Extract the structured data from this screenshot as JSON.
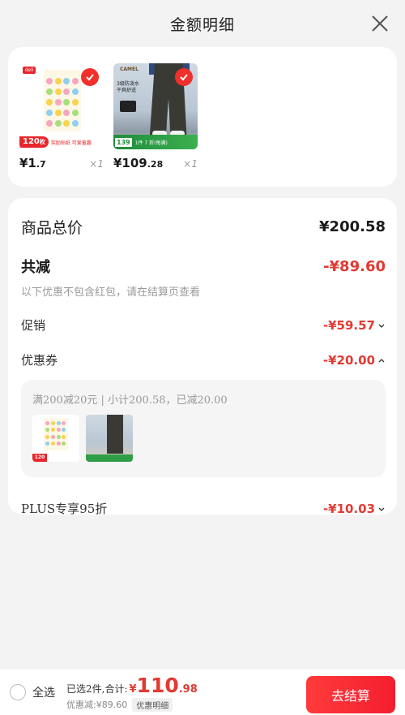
{
  "header": {
    "title": "金额明细",
    "close_icon": "close-icon"
  },
  "products": [
    {
      "price_main": "¥1",
      "price_dec": ".7",
      "qty": "×1",
      "badge": "120",
      "badge_unit": "枚",
      "brand": "deli",
      "banner_text": "奖励贴纸 可爱童趣"
    },
    {
      "price_main": "¥109",
      "price_dec": ".28",
      "qty": "×1",
      "brand": "CAMEL",
      "sub_text": "3级防泼水\n干爽舒适",
      "badge": "139",
      "banner_text": "1件 7 折(每满)"
    }
  ],
  "detail": {
    "total_label": "商品总价",
    "total_value": "¥200.58",
    "discount_label": "共减",
    "discount_value": "-¥89.60",
    "note": "以下优惠不包含红包，请在结算页查看",
    "promo_label": "促销",
    "promo_value": "-¥59.57",
    "coupon_label": "优惠券",
    "coupon_value": "-¥20.00",
    "coupon_desc": "满200减20元 | 小计200.58，已减20.00",
    "plus_label": "PLUS专享95折",
    "plus_value": "-¥10.03"
  },
  "bottom": {
    "select_all": "全选",
    "summary_label": "已选2件,合计:",
    "price_symbol": "¥",
    "price_main": "110",
    "price_dec": ".98",
    "discount_text": "优惠减:¥89.60",
    "detail_tag": "优惠明细",
    "checkout": "去结算"
  },
  "colors": {
    "accent": "#e23a32",
    "checkout": "#f41e2e",
    "check_badge": "#f0302c"
  }
}
